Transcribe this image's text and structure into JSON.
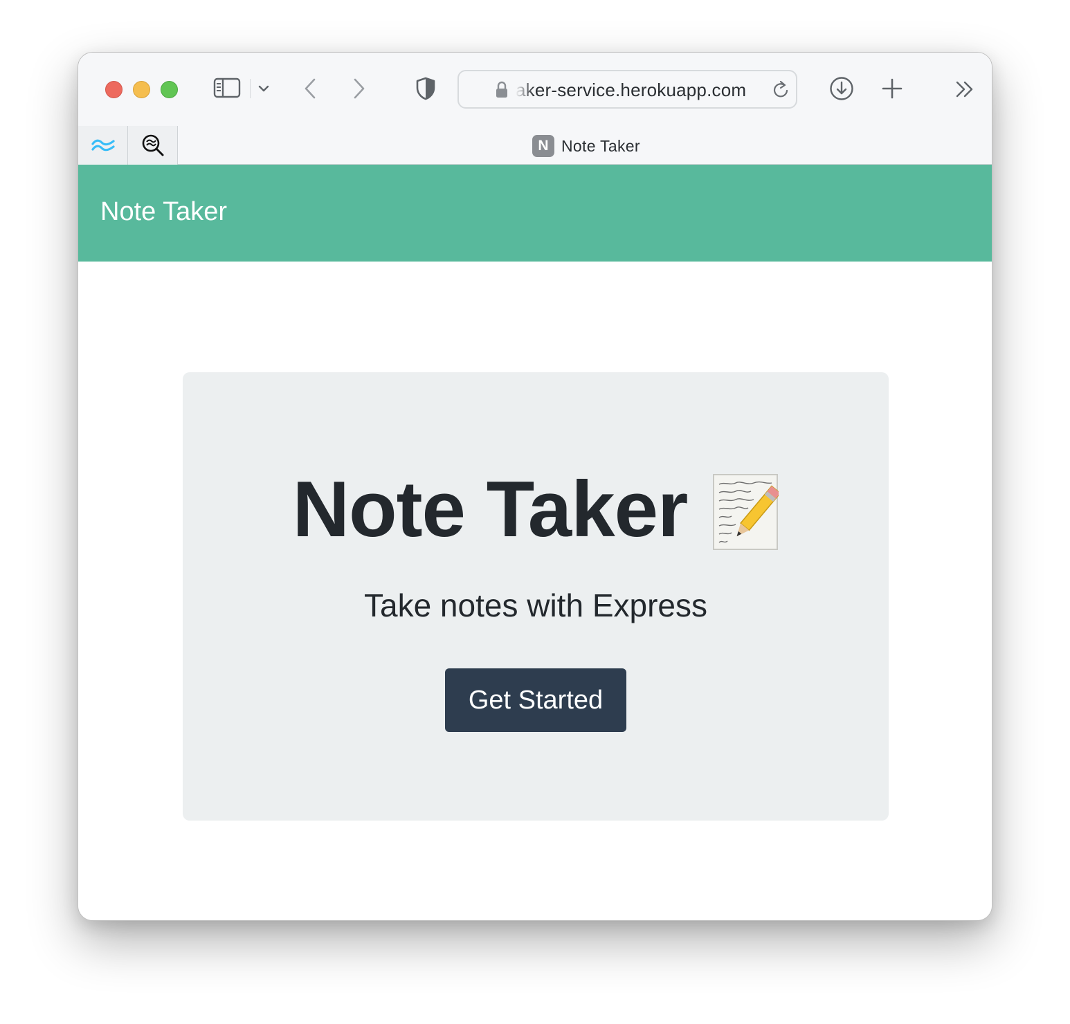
{
  "browser": {
    "address": {
      "url": "aker-service.herokuapp.com"
    },
    "tab": {
      "favicon_letter": "N",
      "title": "Note Taker"
    },
    "icons": {
      "sidebar": "sidebar-icon",
      "sidebar_menu": "chevron-down-icon",
      "back": "chevron-left-icon",
      "forward": "chevron-right-icon",
      "privacy": "shield-icon",
      "lock": "lock-icon",
      "reload": "reload-icon",
      "downloads": "download-icon",
      "new_tab": "plus-icon",
      "overflow": "double-chevron-right-icon",
      "extension_1": "tailwind-icon",
      "extension_2": "zoom-search-icon"
    }
  },
  "navbar": {
    "brand": "Note Taker"
  },
  "hero": {
    "title": "Note Taker",
    "title_icon": "memo-icon",
    "subtitle": "Take notes with Express",
    "cta_label": "Get Started"
  },
  "colors": {
    "navbar_bg": "#58b99c",
    "hero_bg": "#eceff0",
    "button_bg": "#2e3d4f",
    "text_dark": "#23282d"
  }
}
